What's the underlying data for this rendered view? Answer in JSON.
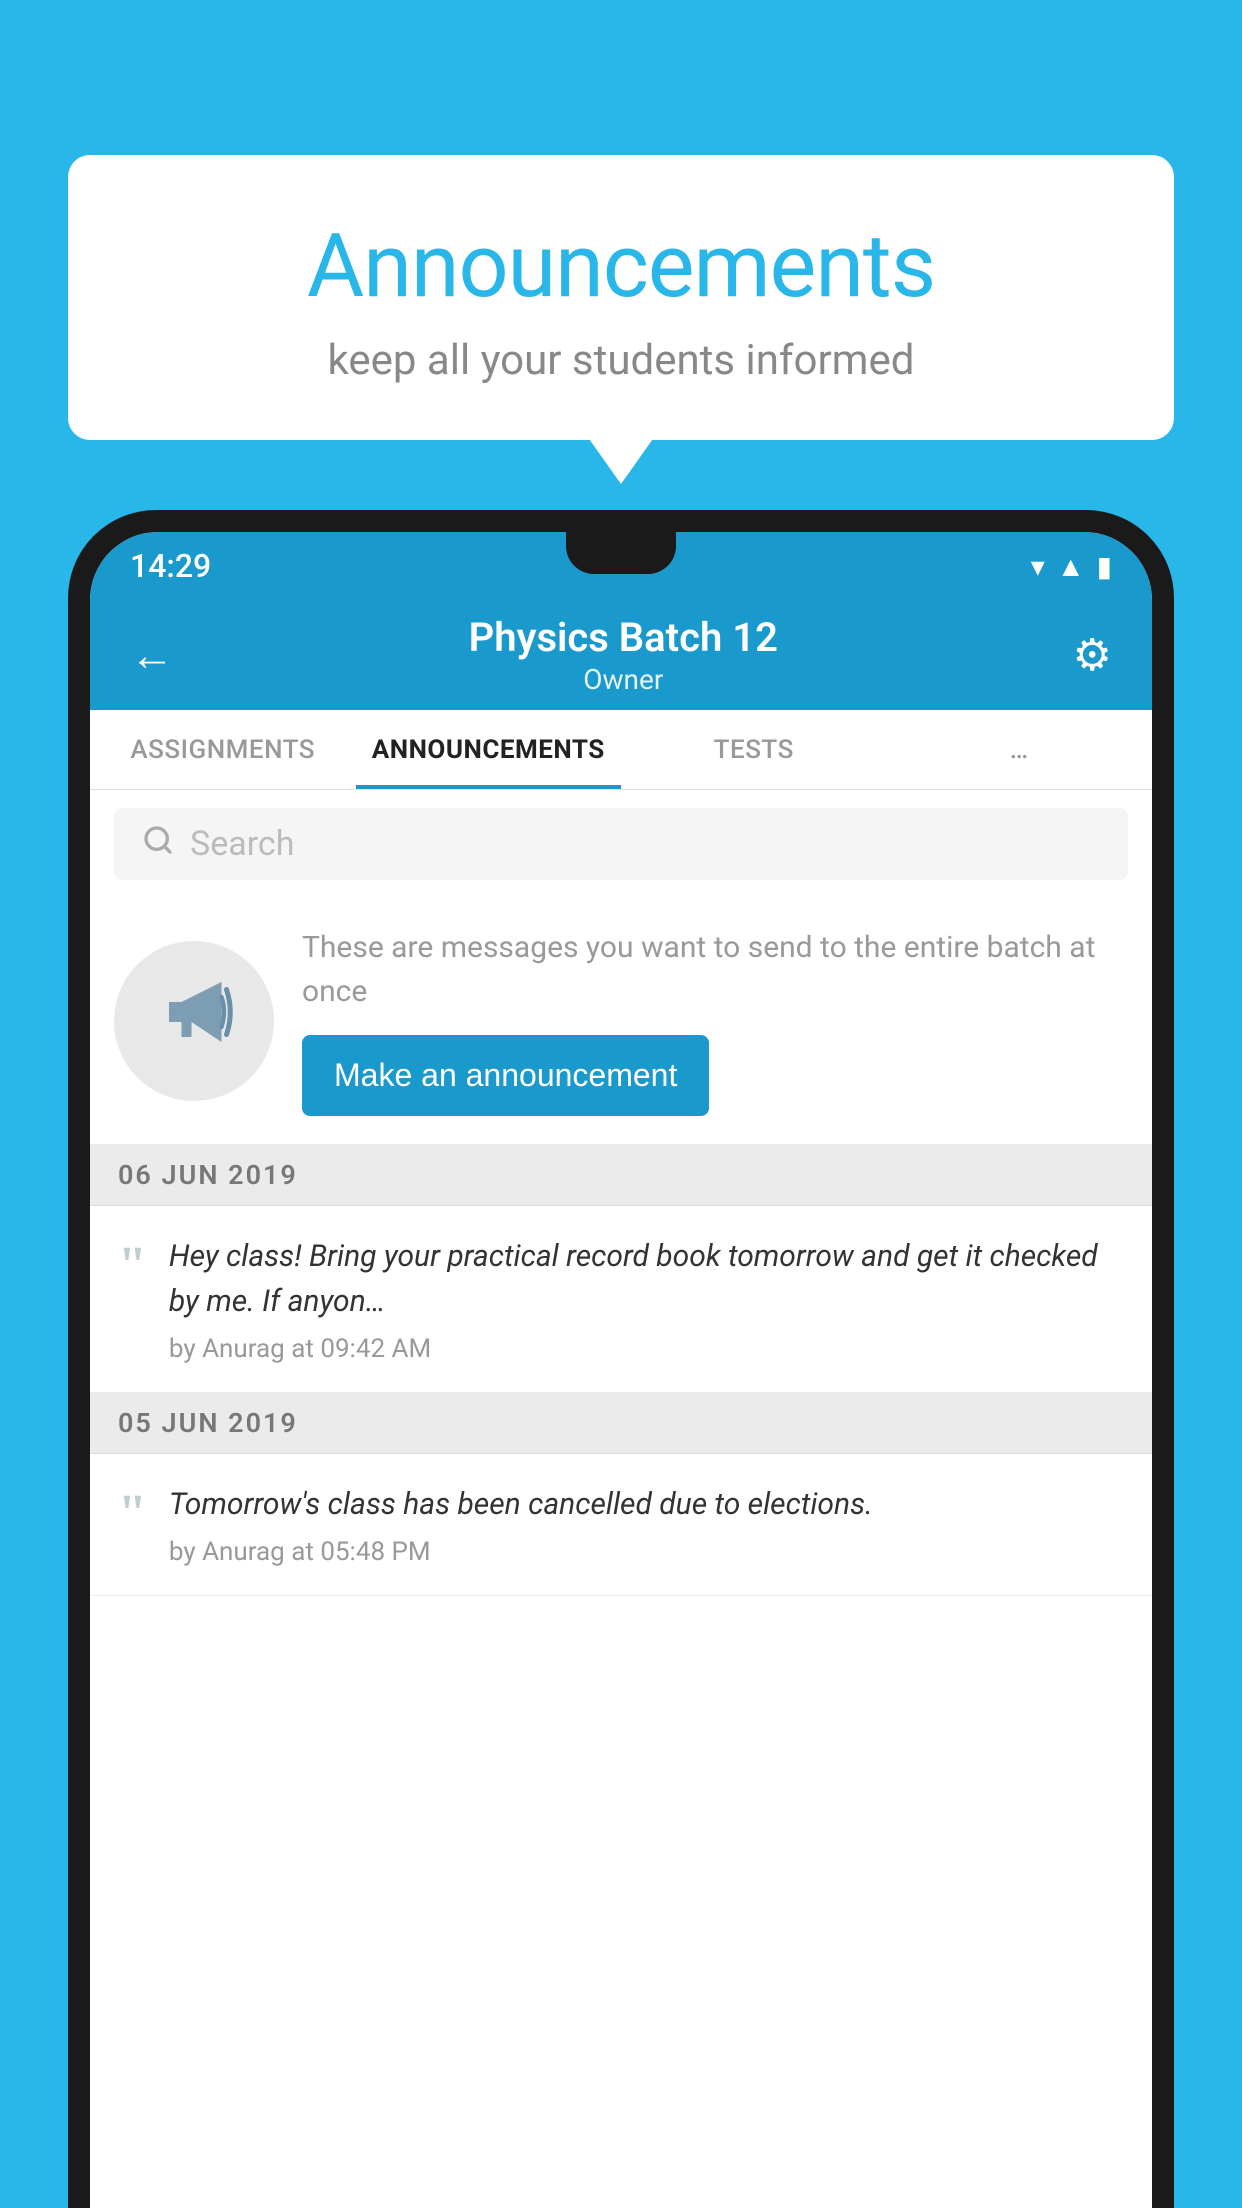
{
  "background_color": "#29b6e8",
  "speech_bubble": {
    "title": "Announcements",
    "subtitle": "keep all your students informed"
  },
  "status_bar": {
    "time": "14:29",
    "icons": [
      "wifi",
      "signal",
      "battery"
    ]
  },
  "app_bar": {
    "title": "Physics Batch 12",
    "subtitle": "Owner",
    "back_label": "←",
    "settings_label": "⚙"
  },
  "tabs": [
    {
      "label": "ASSIGNMENTS",
      "active": false
    },
    {
      "label": "ANNOUNCEMENTS",
      "active": true
    },
    {
      "label": "TESTS",
      "active": false
    },
    {
      "label": "…",
      "active": false
    }
  ],
  "search": {
    "placeholder": "Search"
  },
  "empty_state": {
    "description": "These are messages you want to\nsend to the entire batch at once",
    "button_label": "Make an announcement"
  },
  "date_sections": [
    {
      "date": "06  JUN  2019",
      "announcements": [
        {
          "text": "Hey class! Bring your practical record book tomorrow and get it checked by me. If anyon…",
          "meta": "by Anurag at 09:42 AM"
        }
      ]
    },
    {
      "date": "05  JUN  2019",
      "announcements": [
        {
          "text": "Tomorrow's class has been cancelled due to elections.",
          "meta": "by Anurag at 05:48 PM"
        }
      ]
    }
  ]
}
